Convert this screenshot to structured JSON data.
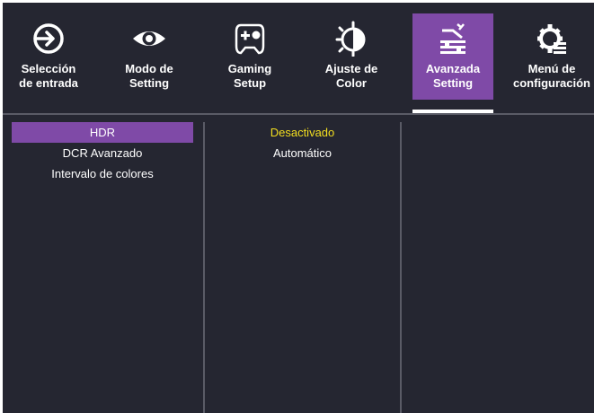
{
  "tabs": [
    {
      "label": "Selección\nde entrada",
      "icon": "input-source-icon"
    },
    {
      "label": "Modo de\nSetting",
      "icon": "eye-icon"
    },
    {
      "label": "Gaming\nSetup",
      "icon": "gamepad-icon"
    },
    {
      "label": "Ajuste de\nColor",
      "icon": "color-adjust-icon"
    },
    {
      "label": "Avanzada\nSetting",
      "icon": "advanced-setting-icon",
      "active": true
    },
    {
      "label": "Menú de\nconfiguración",
      "icon": "settings-gear-icon"
    }
  ],
  "menu": {
    "items": [
      "HDR",
      "DCR Avanzado",
      "Intervalo de colores"
    ],
    "selected": "HDR"
  },
  "options": {
    "items": [
      "Desactivado",
      "Automático"
    ],
    "current": "Desactivado"
  },
  "colors": {
    "accent": "#7f4aa7",
    "background": "#252631",
    "current_value": "#f3de1f"
  }
}
